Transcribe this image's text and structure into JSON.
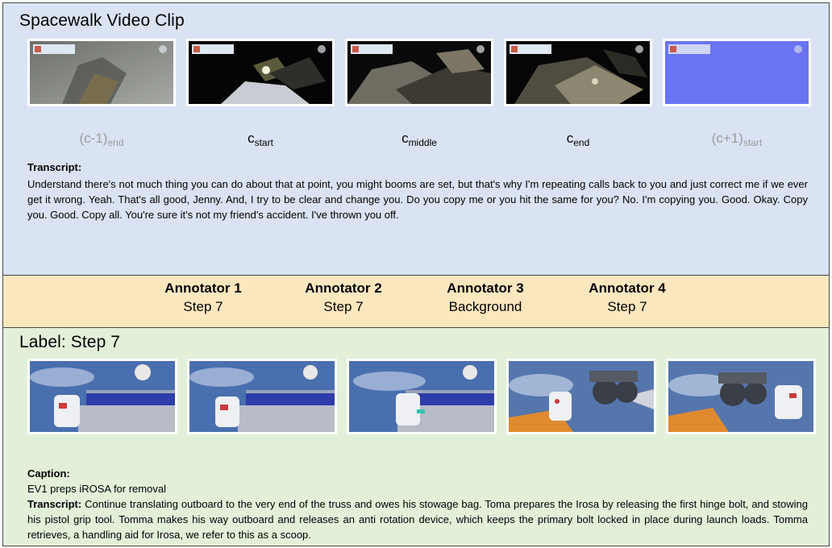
{
  "top": {
    "title": "Spacewalk Video Clip",
    "frame_labels": [
      {
        "base": "(c-1)",
        "sub": "end",
        "faded": true
      },
      {
        "base": "c",
        "sub": "start",
        "faded": false
      },
      {
        "base": "c",
        "sub": "middle",
        "faded": false
      },
      {
        "base": "c",
        "sub": "end",
        "faded": false
      },
      {
        "base": "(c+1)",
        "sub": "start",
        "faded": true
      }
    ],
    "transcript_head": "Transcript:",
    "transcript": "Understand there's not much thing you can do about that at point, you might booms are set, but that's why I'm repeating calls back to you and just correct me if we ever get it wrong. Yeah. That's all good, Jenny. And, I try to be clear and change you. Do you copy me or you hit the same for you? No. I'm copying you. Good. Okay. Copy you. Good. Copy all. You're sure it's not my friend's accident. I've thrown you off."
  },
  "annotators": [
    {
      "name": "Annotator 1",
      "label": "Step 7"
    },
    {
      "name": "Annotator 2",
      "label": "Step 7"
    },
    {
      "name": "Annotator 3",
      "label": "Background"
    },
    {
      "name": "Annotator 4",
      "label": "Step 7"
    }
  ],
  "bottom": {
    "title": "Label: Step 7",
    "caption_head": "Caption:",
    "caption": "EV1 preps iROSA for removal",
    "transcript_head": "Transcript:",
    "transcript": "Continue translating outboard to the very end of the truss and owes his stowage bag. Toma prepares the Irosa by releasing the first hinge bolt, and stowing his pistol grip tool. Tomma makes his way outboard and releases an anti rotation device, which keeps the primary bolt locked in place during launch loads. Tomma retrieves, a handling aid for Irosa, we refer to this as a scoop."
  }
}
